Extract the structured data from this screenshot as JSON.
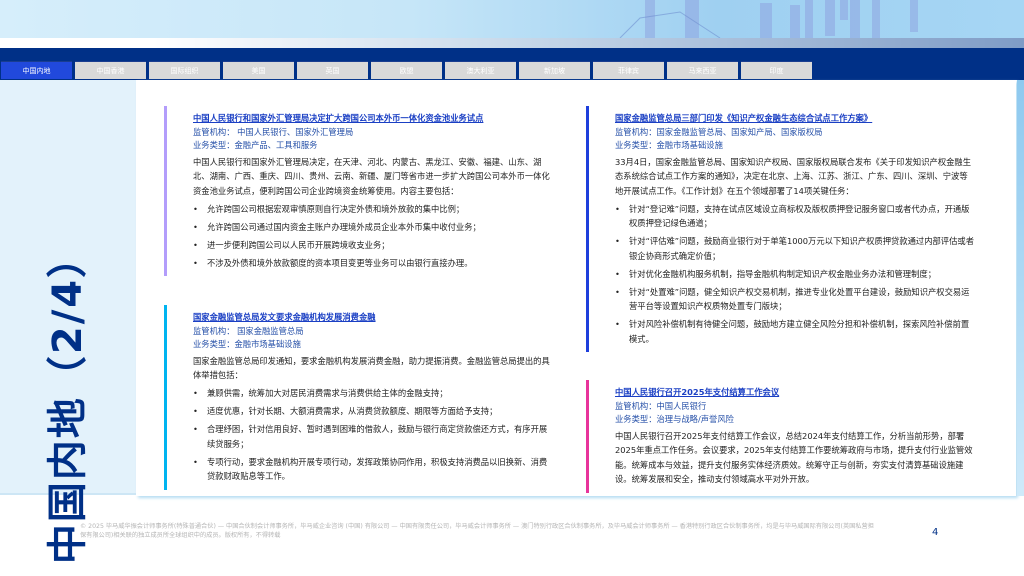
{
  "tabs": [
    "中国内地",
    "中国香港",
    "国际组织",
    "美国",
    "英国",
    "欧盟",
    "澳大利亚",
    "新加坡",
    "菲律宾",
    "马来西亚",
    "印度"
  ],
  "active_tab": 0,
  "side_title": "中国内地（2/4）",
  "colors": {
    "navy": "#003087",
    "active_tab": "#2149dc",
    "bar1": "#b39dfb",
    "bar2": "#00b4f0",
    "bar3": "#1e3fdc",
    "bar4": "#e8349b"
  },
  "sections": [
    {
      "title": "中国人民银行和国家外汇管理局决定扩大跨国公司本外币一体化资金池业务试点",
      "regulator": "监管机构：  中国人民银行、国家外汇管理局",
      "type": "业务类型：金融产品、工具和服务",
      "body": "中国人民银行和国家外汇管理局决定，在天津、河北、内蒙古、黑龙江、安徽、福建、山东、湖北、湖南、广西、重庆、四川、贵州、云南、新疆、厦门等省市进一步扩大跨国公司本外币一体化资金池业务试点，便利跨国公司企业跨境资金统筹使用。内容主要包括：",
      "bullets": [
        "允许跨国公司根据宏观审慎原则自行决定外债和境外放款的集中比例；",
        "允许跨国公司通过国内资金主账户办理境外成员企业本外币集中收付业务；",
        "进一步便利跨国公司以人民币开展跨境收支业务；",
        "不涉及外债和境外放款额度的资本项目变更等业务可以由银行直接办理。"
      ]
    },
    {
      "title": "国家金融监管总局发文要求金融机构发展消费金融",
      "regulator": "监管机构：  国家金融监管总局",
      "type": "业务类型：金融市场基础设施",
      "body": "国家金融监管总局印发通知，要求金融机构发展消费金融，助力提振消费。金融监管总局提出的具体举措包括：",
      "bullets": [
        "兼顾供需，统筹加大对居民消费需求与消费供给主体的金融支持；",
        "适度优惠，针对长期、大额消费需求，从消费贷款额度、期限等方面给予支持；",
        "合理纾困，针对信用良好、暂时遇到困难的借款人，鼓励与银行商定贷款偿还方式，有序开展续贷服务；",
        "专项行动，要求金融机构开展专项行动，发挥政策协同作用，积极支持消费品以旧换新、消费贷款财政贴息等工作。"
      ]
    },
    {
      "title": "国家金融监管总局三部门印发《知识产权金融生态综合试点工作方案》",
      "regulator": "监管机构：国家金融监管总局、国家知产局、国家版权局",
      "type": "业务类型：金融市场基础设施",
      "body": "33月4日，国家金融监管总局、国家知识产权局、国家版权局联合发布《关于印发知识产权金融生态系统综合试点工作方案的通知》，决定在北京、上海、江苏、浙江、广东、四川、深圳、宁波等地开展试点工作。《工作计划》在五个领域部署了14项关键任务：",
      "bullets": [
        "针对“登记难”问题，支持在试点区域设立商标权及版权质押登记服务窗口或者代办点，开通版权质押登记绿色通道；",
        "针对“评估难”问题，鼓励商业银行对于单笔1000万元以下知识产权质押贷款通过内部评估或者银企协商形式确定价值；",
        "针对优化金融机构服务机制，指导金融机构制定知识产权金融业务办法和管理制度；",
        "针对“处置难”问题，健全知识产权交易机制，推进专业化处置平台建设，鼓励知识产权交易运营平台等设置知识产权质物处置专门版块；",
        "针对风险补偿机制有待健全问题，鼓励地方建立健全风险分担和补偿机制，探索风险补偿前置模式。"
      ]
    },
    {
      "title": "中国人民银行召开2025年支付结算工作会议",
      "regulator": "监管机构：中国人民银行",
      "type": "业务类型：治理与战略/声誉风险",
      "body": "中国人民银行召开2025年支付结算工作会议，总结2024年支付结算工作，分析当前形势，部署2025年重点工作任务。会议要求，2025年支付结算工作要统筹政府与市场，提升支付行业监管效能。统筹成本与效益，提升支付服务实体经济质效。统筹守正与创新，夯实支付清算基础设施建设。统筹发展和安全，推动支付领域高水平对外开放。",
      "bullets": []
    }
  ],
  "footer": "© 2025 毕马威华振会计师事务所(特殊普通合伙) — 中国合伙制会计师事务所，毕马威企业咨询 (中国) 有限公司 — 中国有限责任公司，毕马威会计师事务所 — 澳门特别行政区合伙制事务所，及毕马威会计师事务所 — 香港特别行政区合伙制事务所，均是与毕马威国际有限公司(英国私营担保有限公司)相关联的独立成员所全球组织中的成员。版权所有，不得转载",
  "page_number": "4"
}
